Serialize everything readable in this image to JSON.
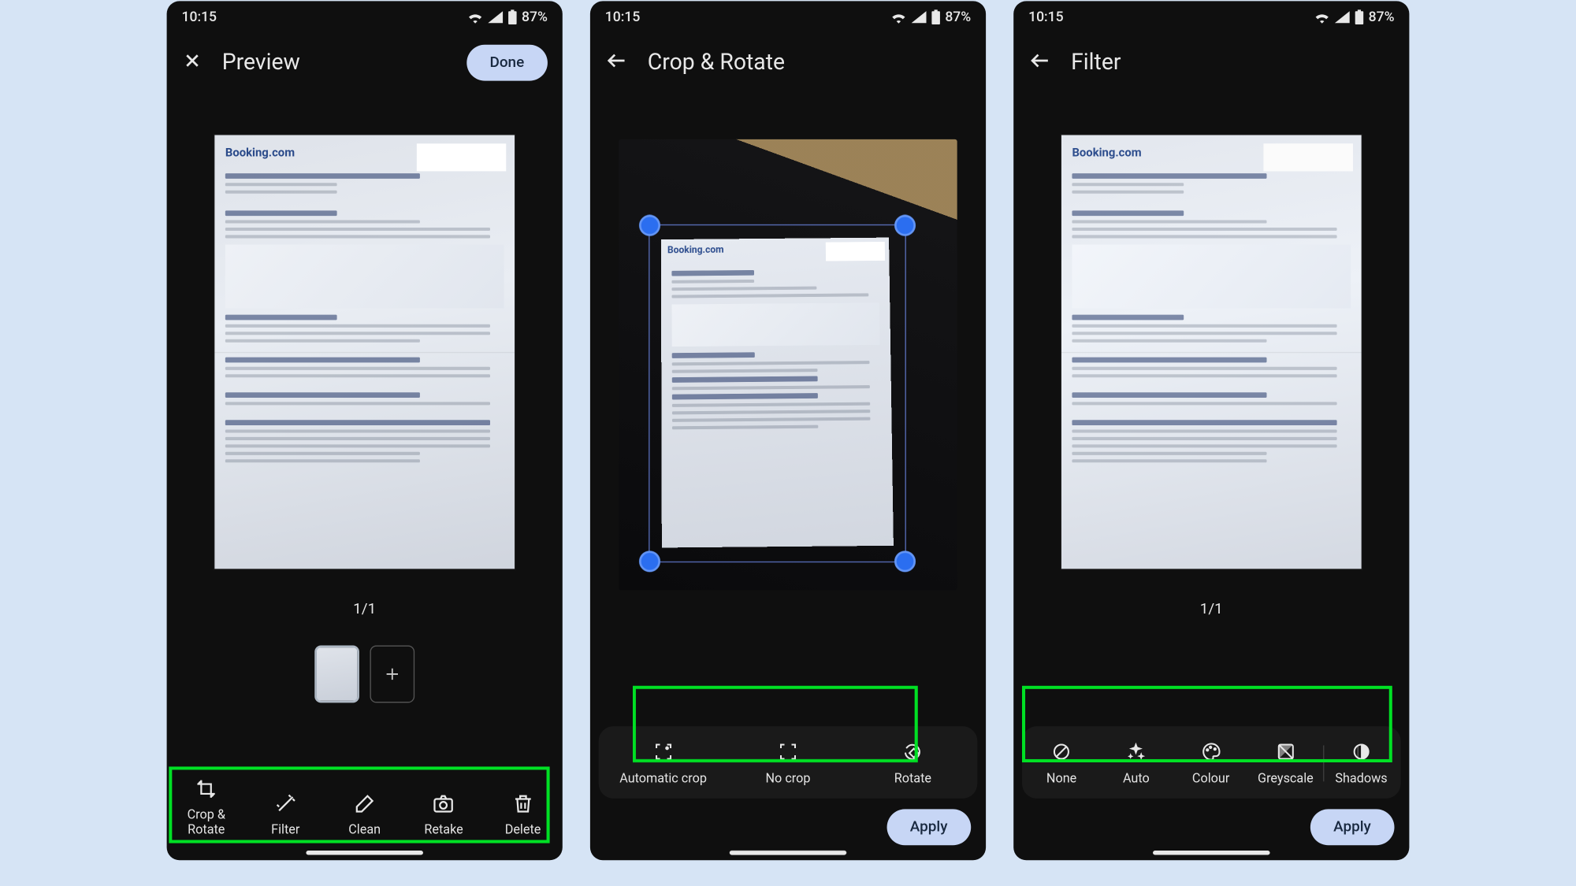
{
  "statusbar": {
    "time": "10:15",
    "battery": "87%"
  },
  "screens": {
    "preview": {
      "title": "Preview",
      "done_label": "Done",
      "page_indicator": "1/1",
      "document_brand": "Booking.com",
      "toolbar": [
        {
          "label": "Crop & Rotate"
        },
        {
          "label": "Filter"
        },
        {
          "label": "Clean"
        },
        {
          "label": "Retake"
        },
        {
          "label": "Delete"
        }
      ]
    },
    "crop": {
      "title": "Crop & Rotate",
      "document_brand": "Booking.com",
      "options": [
        {
          "label": "Automatic crop"
        },
        {
          "label": "No crop"
        },
        {
          "label": "Rotate"
        }
      ],
      "apply_label": "Apply"
    },
    "filter": {
      "title": "Filter",
      "page_indicator": "1/1",
      "document_brand": "Booking.com",
      "options": [
        {
          "label": "None"
        },
        {
          "label": "Auto"
        },
        {
          "label": "Colour"
        },
        {
          "label": "Greyscale"
        },
        {
          "label": "Shadows"
        }
      ],
      "apply_label": "Apply"
    }
  }
}
